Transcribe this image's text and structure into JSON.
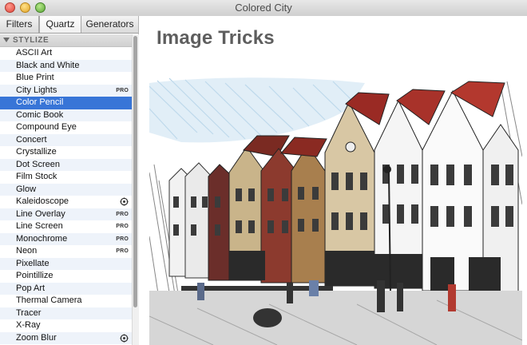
{
  "window": {
    "title": "Colored City"
  },
  "sidebar": {
    "tabs": [
      {
        "label": "Filters",
        "active": false
      },
      {
        "label": "Quartz",
        "active": true
      },
      {
        "label": "Generators",
        "active": false
      }
    ],
    "section": "STYLIZE",
    "items": [
      {
        "label": "ASCII Art",
        "badge": ""
      },
      {
        "label": "Black and White",
        "badge": ""
      },
      {
        "label": "Blue Print",
        "badge": ""
      },
      {
        "label": "City Lights",
        "badge": "PRO"
      },
      {
        "label": "Color Pencil",
        "badge": "",
        "selected": true
      },
      {
        "label": "Comic Book",
        "badge": ""
      },
      {
        "label": "Compound Eye",
        "badge": ""
      },
      {
        "label": "Concert",
        "badge": ""
      },
      {
        "label": "Crystallize",
        "badge": ""
      },
      {
        "label": "Dot Screen",
        "badge": ""
      },
      {
        "label": "Film Stock",
        "badge": ""
      },
      {
        "label": "Glow",
        "badge": ""
      },
      {
        "label": "Kaleidoscope",
        "badge": "",
        "icon": "gear-icon"
      },
      {
        "label": "Line Overlay",
        "badge": "PRO"
      },
      {
        "label": "Line Screen",
        "badge": "PRO"
      },
      {
        "label": "Monochrome",
        "badge": "PRO"
      },
      {
        "label": "Neon",
        "badge": "PRO"
      },
      {
        "label": "Pixellate",
        "badge": ""
      },
      {
        "label": "Pointillize",
        "badge": ""
      },
      {
        "label": "Pop Art",
        "badge": ""
      },
      {
        "label": "Thermal Camera",
        "badge": ""
      },
      {
        "label": "Tracer",
        "badge": ""
      },
      {
        "label": "X-Ray",
        "badge": ""
      },
      {
        "label": "Zoom Blur",
        "badge": "",
        "icon": "gear-icon"
      }
    ]
  },
  "main": {
    "heading": "Image Tricks",
    "preview": {
      "icon": "color-pencil-city-photo"
    }
  },
  "colors": {
    "selection": "#3875d7",
    "heading": "#5e5e5e",
    "sky": "#bcd6ea"
  }
}
